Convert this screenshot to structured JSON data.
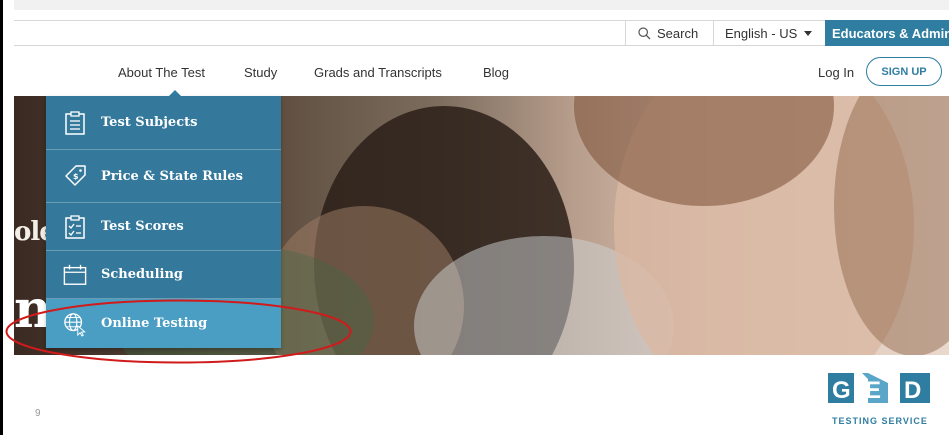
{
  "utility_bar": {
    "search_label": "Search",
    "language_label": "English - US",
    "educators_label": "Educators & Admins"
  },
  "nav": {
    "items": [
      {
        "label": "About The Test"
      },
      {
        "label": "Study"
      },
      {
        "label": "Grads and Transcripts"
      },
      {
        "label": "Blog"
      }
    ],
    "login_label": "Log In",
    "signup_label": "SIGN UP"
  },
  "dropdown": {
    "items": [
      {
        "label": "Test Subjects",
        "icon": "clipboard-list-icon"
      },
      {
        "label": "Price & State Rules",
        "icon": "price-tag-icon"
      },
      {
        "label": "Test Scores",
        "icon": "clipboard-check-icon"
      },
      {
        "label": "Scheduling",
        "icon": "calendar-icon"
      },
      {
        "label": "Online Testing",
        "icon": "globe-cursor-icon"
      }
    ],
    "highlighted_item": "Online Testing"
  },
  "hero": {
    "fragment_top": "ole",
    "fragment_bottom": "n"
  },
  "slide": {
    "page_number": "9"
  },
  "logo": {
    "letters": "GED",
    "tagline": "TESTING SERVICE"
  },
  "colors": {
    "brand_blue": "#2f7ea2",
    "dropdown_bg": "#34789b",
    "dropdown_active": "#4a9ec4",
    "annotation_red": "#d11a1a"
  }
}
